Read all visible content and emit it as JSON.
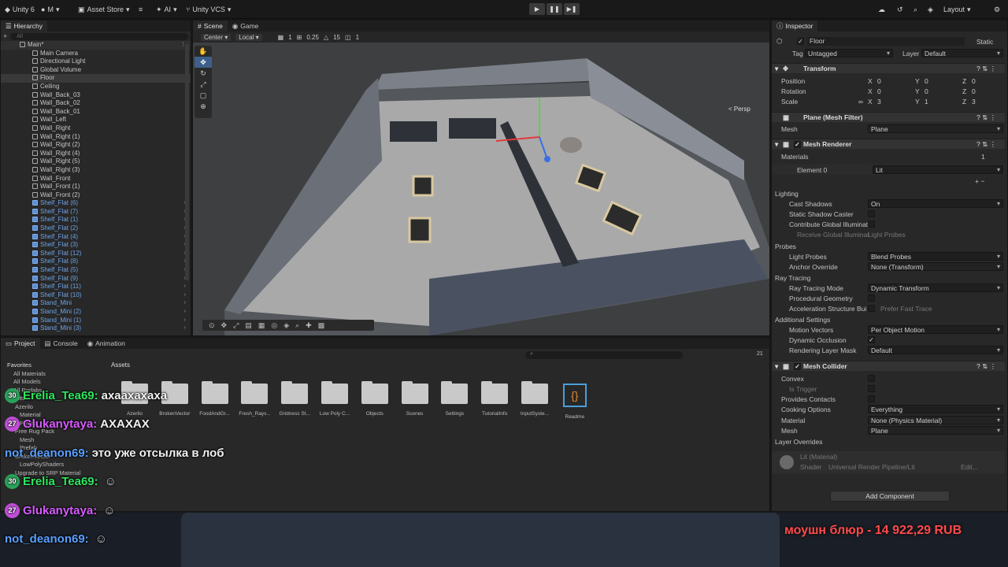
{
  "toolbar": {
    "unity": "Unity 6",
    "account": "M",
    "asset_store": "Asset Store",
    "ai": "AI",
    "vcs": "Unity VCS",
    "layout": "Layout"
  },
  "hierarchy": {
    "tab": "Hierarchy",
    "search_placeholder": "All",
    "scene": "Main*",
    "items": [
      "Main Camera",
      "Directional Light",
      "Global Volume",
      "Floor",
      "Ceiling",
      "Wall_Back_03",
      "Wall_Back_02",
      "Wall_Back_01",
      "Wall_Left",
      "Wall_Right",
      "Wall_Right (1)",
      "Wall_Right (2)",
      "Wall_Right (4)",
      "Wall_Right (5)",
      "Wall_Right (3)",
      "Wall_Front",
      "Wall_Front (1)",
      "Wall_Front (2)",
      "Shelf_Flat (6)",
      "Shelf_Flat (7)",
      "Shelf_Flat (1)",
      "Shelf_Flat (2)",
      "Shelf_Flat (4)",
      "Shelf_Flat (3)",
      "Shelf_Flat (12)",
      "Shelf_Flat (8)",
      "Shelf_Flat (5)",
      "Shelf_Flat (9)",
      "Shelf_Flat (11)",
      "Shelf_Flat (10)",
      "Stand_Mini",
      "Stand_Mini (2)",
      "Stand_Mini (1)",
      "Stand_Mini (3)"
    ]
  },
  "scene": {
    "tab_scene": "Scene",
    "tab_game": "Game",
    "pivot": "Center",
    "space": "Local",
    "grid": "1",
    "snap": "0.25",
    "angle": "15",
    "scale": "1",
    "persp": "< Persp"
  },
  "inspector": {
    "tab": "Inspector",
    "object_name": "Floor",
    "static": "Static",
    "tag_label": "Tag",
    "tag": "Untagged",
    "layer_label": "Layer",
    "layer": "Default",
    "transform": "Transform",
    "position": "Position",
    "rotation": "Rotation",
    "scale": "Scale",
    "pos": [
      "0",
      "0",
      "0"
    ],
    "rot": [
      "0",
      "0",
      "0"
    ],
    "scl": [
      "3",
      "1",
      "3"
    ],
    "x": "X",
    "y": "Y",
    "z": "Z",
    "mesh_filter": "Plane (Mesh Filter)",
    "mesh_label": "Mesh",
    "mesh": "Plane",
    "mesh_renderer": "Mesh Renderer",
    "materials": "Materials",
    "materials_count": "1",
    "element0": "Element 0",
    "element0_value": "Lit",
    "lighting": "Lighting",
    "cast_shadows": "Cast Shadows",
    "cast_shadows_val": "On",
    "static_shadow": "Static Shadow Caster",
    "contribute_gi": "Contribute Global Illuminati",
    "receive_gi": "Receive Global Illuminat",
    "receive_gi_val": "Light Probes",
    "probes": "Probes",
    "light_probes": "Light Probes",
    "light_probes_val": "Blend Probes",
    "anchor": "Anchor Override",
    "anchor_val": "None (Transform)",
    "ray_tracing": "Ray Tracing",
    "rt_mode": "Ray Tracing Mode",
    "rt_mode_val": "Dynamic Transform",
    "proc_geo": "Procedural Geometry",
    "accel": "Acceleration Structure Bui",
    "accel_val": "Prefer Fast Trace",
    "additional": "Additional Settings",
    "motion": "Motion Vectors",
    "motion_val": "Per Object Motion",
    "occlusion": "Dynamic Occlusion",
    "render_mask": "Rendering Layer Mask",
    "render_mask_val": "Default",
    "mesh_collider": "Mesh Collider",
    "convex": "Convex",
    "is_trigger": "Is Trigger",
    "provides": "Provides Contacts",
    "cooking": "Cooking Options",
    "cooking_val": "Everything",
    "material": "Material",
    "material_val": "None (Physics Material)",
    "mesh_val": "Plane",
    "layer_overrides": "Layer Overrides",
    "lit_material": "Lit (Material)",
    "shader": "Shader",
    "shader_val": "Universal Render Pipeline/Lit",
    "edit": "Edit...",
    "add_component": "Add Component"
  },
  "project": {
    "tab_project": "Project",
    "tab_console": "Console",
    "tab_animation": "Animation",
    "assets": "Assets",
    "count": "21",
    "tree": [
      "Favorites",
      "All Materials",
      "All Models",
      "All Prefabs",
      "Assets",
      "Azerilo",
      "Material",
      "Prefab",
      "Free Rug Pack",
      "Mesh",
      "Prefab",
      "BrokenVector",
      "LowPolyShaders",
      "Upgrade to SRP Material"
    ],
    "folders": [
      "Azerilo",
      "BrokenVector",
      "FoodAndGr...",
      "Fresh_Rays...",
      "Gridness St...",
      "Low Poly C...",
      "Objects",
      "Scenes",
      "Settings",
      "TutorialInfo",
      "InputSyste...",
      "Readme"
    ]
  },
  "chat": [
    {
      "badge": "30",
      "nick": "Erelia_Tea69:",
      "msg": "ахаахахаха",
      "color": "g"
    },
    {
      "badge": "27",
      "nick": "Glukanytaya:",
      "msg": "АХАХАХ",
      "color": "p"
    },
    {
      "badge": "",
      "nick": "not_deanon69:",
      "msg": "это уже отсылка в лоб",
      "color": "b"
    },
    {
      "badge": "30",
      "nick": "Erelia_Tea69:",
      "msg": "",
      "color": "g"
    },
    {
      "badge": "27",
      "nick": "Glukanytaya:",
      "msg": "",
      "color": "p"
    },
    {
      "badge": "",
      "nick": "not_deanon69:",
      "msg": "",
      "color": "b"
    }
  ],
  "donation": "моушн блюр - 14 922,29 RUB"
}
